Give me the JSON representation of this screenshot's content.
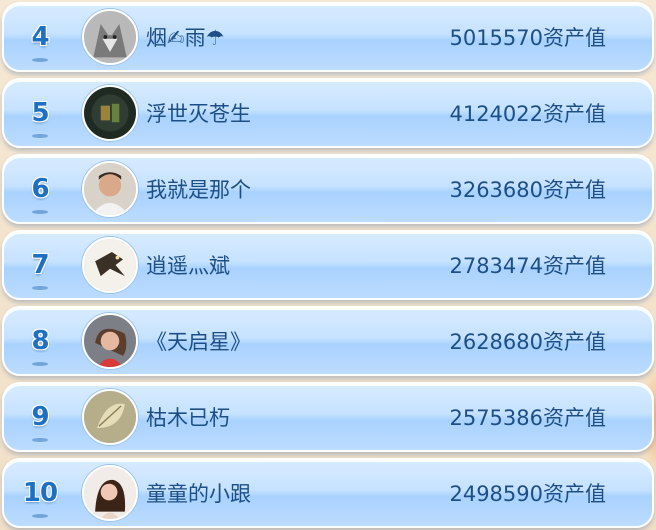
{
  "leaderboard": {
    "rows": [
      {
        "rank": "4",
        "name": "烟✍雨☂",
        "score": "5015570",
        "unit": "资产值",
        "avatar_icon": "wolf-avatar-icon"
      },
      {
        "rank": "5",
        "name": "浮世灭苍生",
        "score": "4124022",
        "unit": "资产值",
        "avatar_icon": "dark-calligraphy-avatar-icon"
      },
      {
        "rank": "6",
        "name": "我就是那个",
        "score": "3263680",
        "unit": "资产值",
        "avatar_icon": "man-portrait-avatar-icon"
      },
      {
        "rank": "7",
        "name": "逍遥灬斌",
        "score": "2783474",
        "unit": "资产值",
        "avatar_icon": "eagle-avatar-icon"
      },
      {
        "rank": "8",
        "name": "《天启星》",
        "score": "2628680",
        "unit": "资产值",
        "avatar_icon": "woman-portrait-avatar-icon"
      },
      {
        "rank": "9",
        "name": "枯木已朽",
        "score": "2575386",
        "unit": "资产值",
        "avatar_icon": "dry-leaf-avatar-icon"
      },
      {
        "rank": "10",
        "name": "童童的小跟",
        "score": "2498590",
        "unit": "资产值",
        "avatar_icon": "girl-portrait-avatar-icon"
      }
    ]
  },
  "colors": {
    "row_top": "#d9ecff",
    "row_bottom": "#a9d2ff",
    "rank_text": "#1f6fc2",
    "label_text": "#1d4f86",
    "background": "#f3e4cf"
  }
}
